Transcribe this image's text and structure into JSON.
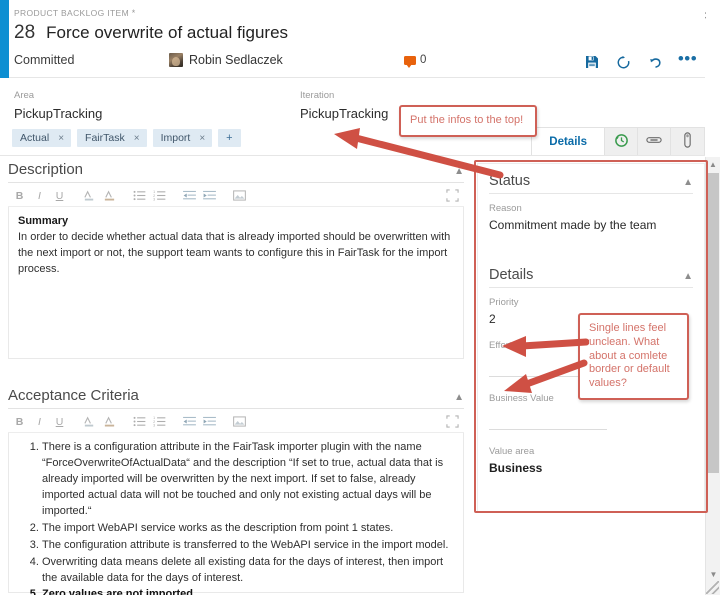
{
  "window": {
    "close_label": "×"
  },
  "header": {
    "breadcrumb": "PRODUCT BACKLOG ITEM",
    "dirty_marker": "*",
    "work_item_id": "28",
    "title": "Force overwrite of actual figures",
    "state": "Committed",
    "assignee": "Robin Sedlaczek",
    "comment_count": "0",
    "actions": [
      {
        "name": "save-button",
        "icon": "save-icon"
      },
      {
        "name": "refresh-button",
        "icon": "refresh-icon"
      },
      {
        "name": "undo-button",
        "icon": "undo-icon"
      },
      {
        "name": "more-actions-button",
        "icon": "ellipsis-icon",
        "label": "•••"
      }
    ]
  },
  "info": {
    "area_label": "Area",
    "area_value": "PickupTracking",
    "iteration_label": "Iteration",
    "iteration_value": "PickupTracking",
    "tags": [
      "Actual",
      "FairTask",
      "Import"
    ],
    "tag_remove": "×",
    "tag_add": "+"
  },
  "tabs": [
    {
      "label": "Details",
      "name": "tab-details",
      "active": true
    },
    {
      "label": "",
      "name": "tab-history",
      "icon": "history-clock-icon",
      "active": false
    },
    {
      "label": "",
      "name": "tab-links",
      "icon": "link-icon",
      "active": false
    },
    {
      "label": "",
      "name": "tab-attachments",
      "icon": "attachment-icon",
      "active": false
    }
  ],
  "editor_toolbar": [
    {
      "name": "bold-icon",
      "glyph": "B"
    },
    {
      "name": "italic-icon",
      "glyph": "I"
    },
    {
      "name": "underline-icon",
      "glyph": "U"
    },
    {
      "name": "text-color-icon",
      "glyph": ""
    },
    {
      "name": "highlight-color-icon",
      "glyph": ""
    },
    {
      "name": "bullet-list-icon",
      "glyph": ""
    },
    {
      "name": "numbered-list-icon",
      "glyph": ""
    },
    {
      "name": "outdent-icon",
      "glyph": ""
    },
    {
      "name": "indent-icon",
      "glyph": ""
    },
    {
      "name": "insert-image-icon",
      "glyph": ""
    },
    {
      "name": "expand-editor-icon",
      "glyph": ""
    }
  ],
  "description": {
    "section_title": "Description",
    "summary_heading": "Summary",
    "body": "In order to decide whether actual data that is already imported should be overwritten with the next import or not, the support team wants to configure this in FairTask for the import process."
  },
  "acceptance": {
    "section_title": "Acceptance Criteria",
    "items": [
      "There is a configuration attribute in the FairTask importer plugin with the name “ForceOverwriteOfActualData“ and the description “If set to true, actual data that is already imported will be overwritten by the next import. If set to false, already imported actual data will not be touched and only not existing actual days will be imported.“",
      "The import WebAPI service works as the description from point 1 states.",
      "The configuration attribute is transferred to the WebAPI service in the import model.",
      "Overwriting data means delete all existing data for the days of interest, then import the available data for the days of interest.",
      "Zero values are not imported."
    ],
    "last_item_bold": true
  },
  "side_panel": {
    "status": {
      "title": "Status",
      "reason_label": "Reason",
      "reason_value": "Commitment made by the team"
    },
    "details": {
      "title": "Details",
      "priority_label": "Priority",
      "priority_value": "2",
      "effort_label": "Effort",
      "effort_value": "",
      "business_value_label": "Business Value",
      "business_value_value": "",
      "value_area_label": "Value area",
      "value_area_value": "Business"
    }
  },
  "annotations": [
    {
      "id": "anno-top",
      "text": "Put the infos to the top!"
    },
    {
      "id": "anno-side",
      "text": "Single lines feel unclean. What about a comlete border or default values?"
    }
  ],
  "colors": {
    "accent_blue": "#0e8fd2",
    "action_blue": "#16699e",
    "tag_bg": "#dfeaf3",
    "annotation_red": "#cf6056",
    "comment_orange": "#e8620c"
  }
}
